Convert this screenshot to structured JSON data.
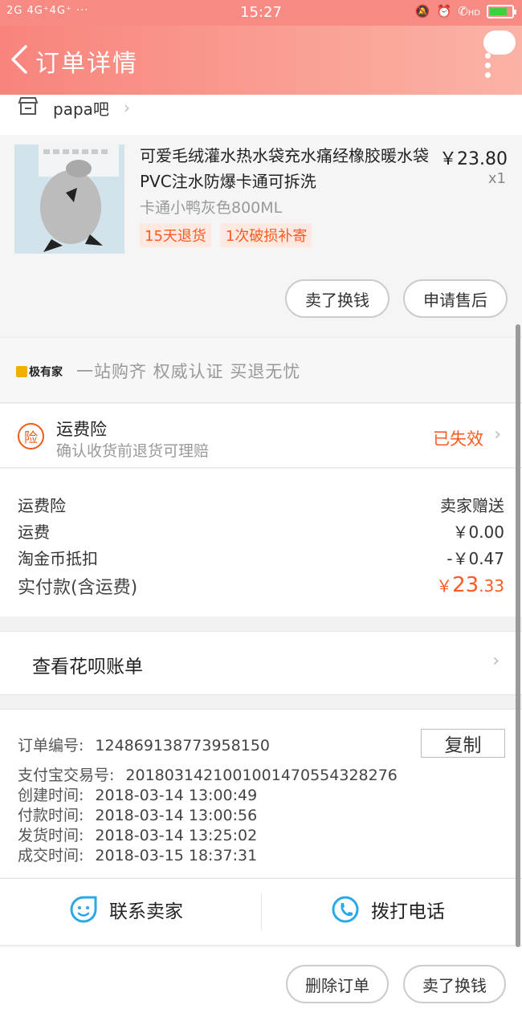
{
  "status_bar": {
    "signal": "2G 4G⁺4G⁺ ···",
    "time": "15:27",
    "hd": "HD"
  },
  "nav": {
    "title": "订单详情"
  },
  "shop": {
    "name": "papa吧"
  },
  "item": {
    "title": "可爱毛绒灌水热水袋充水痛经橡胶暖水袋PVC注水防爆卡通可拆洗",
    "price": "￥23.80",
    "qty": "x1",
    "sku": "卡通小鸭灰色800ML",
    "tags": [
      "15天退货",
      "1次破损补寄"
    ],
    "buttons": {
      "sell": "卖了换钱",
      "after_sale": "申请售后"
    }
  },
  "promo": {
    "brand": "极有家",
    "slogan": "一站购齐 权威认证 买退无忧"
  },
  "insurance": {
    "badge": "险",
    "title": "运费险",
    "desc": "确认收货前退货可理赔",
    "status": "已失效"
  },
  "costs": {
    "rows": [
      {
        "label": "运费险",
        "value": "卖家赠送"
      },
      {
        "label": "运费",
        "value": "￥0.00"
      },
      {
        "label": "淘金币抵扣",
        "value": "-￥0.47"
      }
    ],
    "total_label": "实付款(含运费)",
    "total_currency": "￥",
    "total_int": "23",
    "total_dec": ".33"
  },
  "huabei": {
    "label": "查看花呗账单"
  },
  "order_info": {
    "copy_label": "复制",
    "lines": [
      {
        "label": "订单编号:",
        "value": "124869138773958150"
      },
      {
        "label": "支付宝交易号:",
        "value": "2018031421001001470554328276"
      },
      {
        "label": "创建时间:",
        "value": "2018-03-14 13:00:49"
      },
      {
        "label": "付款时间:",
        "value": "2018-03-14 13:00:56"
      },
      {
        "label": "发货时间:",
        "value": "2018-03-14 13:25:02"
      },
      {
        "label": "成交时间:",
        "value": "2018-03-15 18:37:31"
      }
    ]
  },
  "contact": {
    "seller": "联系卖家",
    "phone": "拨打电话"
  },
  "bottom": {
    "delete": "删除订单",
    "sell": "卖了换钱"
  },
  "colors": {
    "accent": "#ff5a1f",
    "nav_start": "#f8847c",
    "nav_end": "#fbb3a6",
    "icon_blue": "#2aa8e8"
  }
}
